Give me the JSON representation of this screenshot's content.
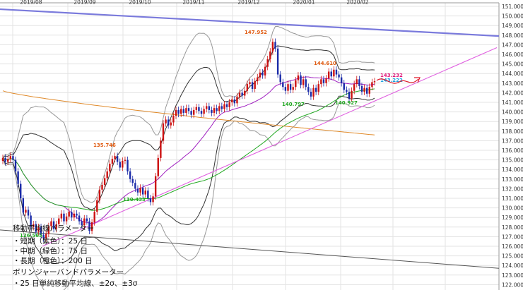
{
  "chart_data": {
    "type": "candlestick",
    "x_ticks": [
      "2019/08",
      "2019/09",
      "2019/10",
      "2019/11",
      "2019/12",
      "2020/01",
      "2020/02"
    ],
    "y_ticks": [
      "151.000",
      "150.000",
      "149.000",
      "148.000",
      "147.000",
      "146.000",
      "145.000",
      "144.000",
      "143.000",
      "142.000",
      "141.000",
      "140.000",
      "139.000",
      "138.000",
      "137.000",
      "136.000",
      "135.000",
      "134.000",
      "133.000",
      "132.000",
      "131.000",
      "130.000",
      "129.000",
      "128.000",
      "127.000",
      "126.000",
      "125.000",
      "124.000",
      "123.000",
      "122.000",
      "121.000"
    ],
    "ylim": [
      120.6,
      151.2
    ],
    "grid": true,
    "up_color": "#cc1111",
    "down_color": "#1a2aa8",
    "ma_colors": {
      "short": "#a020c0",
      "mid": "#22a822",
      "long": "#e08a2a"
    },
    "bollinger_colors": {
      "sigma2": "#333333",
      "sigma3": "#999999"
    },
    "trendline_colors": {
      "upper": "#7a7adc",
      "lower_support": "#e060e0",
      "bottom": "#555555"
    },
    "point_labels": [
      {
        "text": "126.565",
        "color": "#22a822"
      },
      {
        "text": "135.746",
        "color": "#e05a10"
      },
      {
        "text": "130.433",
        "color": "#22a822"
      },
      {
        "text": "147.952",
        "color": "#e05a10"
      },
      {
        "text": "140.797",
        "color": "#22a822"
      },
      {
        "text": "144.610",
        "color": "#e05a10"
      },
      {
        "text": "140.927",
        "color": "#22a822"
      },
      {
        "text": "143.232",
        "color": "#e0197a"
      },
      {
        "text": "143.222",
        "color": "#1aa0e0"
      }
    ],
    "legend": [
      "移動平均線パラメーター",
      "・短期（紫色）：25 日",
      "・中期（緑色）：75 日",
      "・長期（橙色）：200 日",
      "ボリンジャーバンドパラメーター",
      "・25 日単純移動平均線、±2σ、±3σ"
    ],
    "closes": [
      135.2,
      134.8,
      135.1,
      135.4,
      135.0,
      133.8,
      132.5,
      131.0,
      129.5,
      129.8,
      129.2,
      128.0,
      128.3,
      127.5,
      128.0,
      127.2,
      126.8,
      127.3,
      128.1,
      128.6,
      127.8,
      128.3,
      128.9,
      129.4,
      128.6,
      129.1,
      129.6,
      129.0,
      129.4,
      129.2,
      128.6,
      128.2,
      128.9,
      128.6,
      127.6,
      128.5,
      129.6,
      130.8,
      131.9,
      132.4,
      133.1,
      133.8,
      134.6,
      135.1,
      135.4,
      134.8,
      134.2,
      134.9,
      135.0,
      133.8,
      133.0,
      132.6,
      132.0,
      131.6,
      132.1,
      131.4,
      131.8,
      131.0,
      130.6,
      131.2,
      133.3,
      135.2,
      137.0,
      138.8,
      139.2,
      138.6,
      138.9,
      139.6,
      140.2,
      139.8,
      140.3,
      139.9,
      140.4,
      140.1,
      139.7,
      140.2,
      140.5,
      140.1,
      139.8,
      140.3,
      140.6,
      140.2,
      139.9,
      140.4,
      140.1,
      140.6,
      140.3,
      140.8,
      140.5,
      141.0,
      141.3,
      140.9,
      141.6,
      142.0,
      141.7,
      142.2,
      142.9,
      143.1,
      142.4,
      143.2,
      143.6,
      144.1,
      143.8,
      144.7,
      145.5,
      146.3,
      147.3,
      146.6,
      143.9,
      143.1,
      142.6,
      142.2,
      142.9,
      142.3,
      142.6,
      143.3,
      143.8,
      142.8,
      143.4,
      142.6,
      142.1,
      141.6,
      142.5,
      142.1,
      142.9,
      143.4,
      143.0,
      143.5,
      144.2,
      143.7,
      144.4,
      143.9,
      143.6,
      143.0,
      142.3,
      142.1,
      141.4,
      142.2,
      142.9,
      143.4,
      142.7,
      142.1,
      142.5,
      141.9,
      142.6,
      143.1,
      143.2
    ]
  }
}
